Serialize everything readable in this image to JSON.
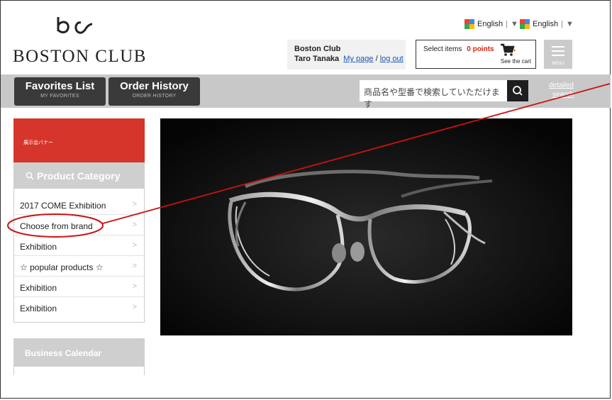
{
  "logo": {
    "text": "BOSTON CLUB",
    "icon": "glasses-logo-icon"
  },
  "lang": [
    {
      "label": "English",
      "caret": "▼"
    },
    {
      "label": "English",
      "caret": "▼"
    }
  ],
  "user": {
    "org": "Boston Club",
    "name": "Taro Tanaka",
    "mypage": "My page",
    "slash": "/",
    "logout": "log out"
  },
  "cart": {
    "select_label": "Select items",
    "points": "0 points",
    "see_cart": "See the cart"
  },
  "menu": {
    "label": "MENU"
  },
  "nav": {
    "favorites": {
      "title": "Favorites List",
      "sub": "MY FAVORITES"
    },
    "orders": {
      "title": "Order History",
      "sub": "ORDER HISTORY"
    }
  },
  "search": {
    "placeholder": "商品名や型番で検索していただけます",
    "detailed": "detailed",
    "search_word": "search"
  },
  "sidebar": {
    "banner": "展示会バナー",
    "category_title": "Product Category",
    "items": [
      {
        "label": "2017 COME Exhibition"
      },
      {
        "label": "Choose from brand"
      },
      {
        "label": "Exhibition"
      },
      {
        "label": "☆ popular products ☆"
      },
      {
        "label": "Exhibition"
      },
      {
        "label": "Exhibition"
      }
    ],
    "arrow": ">",
    "calendar_title": "Business Calendar"
  },
  "colors": {
    "accent_red": "#d6352c",
    "nav_dark": "#3a3a3a",
    "band_gray": "#c8c8c8",
    "annotation": "#cc1111"
  }
}
